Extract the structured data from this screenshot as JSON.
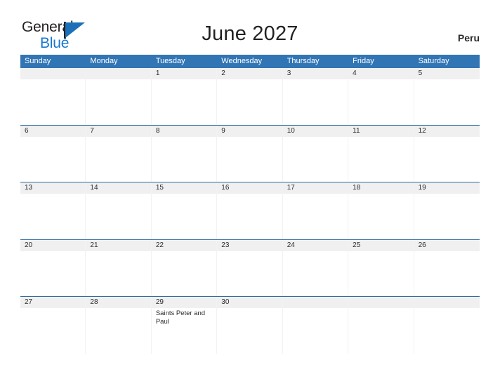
{
  "brand": {
    "name_part1": "General",
    "name_part2": "Blue",
    "flag_icon": "flag-icon",
    "accent_color": "#1878cf"
  },
  "header": {
    "title": "June 2027",
    "country": "Peru"
  },
  "calendar": {
    "header_color": "#3175b5",
    "band_color": "#f0f0f0",
    "weekdays": [
      "Sunday",
      "Monday",
      "Tuesday",
      "Wednesday",
      "Thursday",
      "Friday",
      "Saturday"
    ],
    "weeks": [
      [
        {
          "day": "",
          "events": []
        },
        {
          "day": "",
          "events": []
        },
        {
          "day": "1",
          "events": []
        },
        {
          "day": "2",
          "events": []
        },
        {
          "day": "3",
          "events": []
        },
        {
          "day": "4",
          "events": []
        },
        {
          "day": "5",
          "events": []
        }
      ],
      [
        {
          "day": "6",
          "events": []
        },
        {
          "day": "7",
          "events": []
        },
        {
          "day": "8",
          "events": []
        },
        {
          "day": "9",
          "events": []
        },
        {
          "day": "10",
          "events": []
        },
        {
          "day": "11",
          "events": []
        },
        {
          "day": "12",
          "events": []
        }
      ],
      [
        {
          "day": "13",
          "events": []
        },
        {
          "day": "14",
          "events": []
        },
        {
          "day": "15",
          "events": []
        },
        {
          "day": "16",
          "events": []
        },
        {
          "day": "17",
          "events": []
        },
        {
          "day": "18",
          "events": []
        },
        {
          "day": "19",
          "events": []
        }
      ],
      [
        {
          "day": "20",
          "events": []
        },
        {
          "day": "21",
          "events": []
        },
        {
          "day": "22",
          "events": []
        },
        {
          "day": "23",
          "events": []
        },
        {
          "day": "24",
          "events": []
        },
        {
          "day": "25",
          "events": []
        },
        {
          "day": "26",
          "events": []
        }
      ],
      [
        {
          "day": "27",
          "events": []
        },
        {
          "day": "28",
          "events": []
        },
        {
          "day": "29",
          "events": [
            "Saints Peter and Paul"
          ]
        },
        {
          "day": "30",
          "events": []
        },
        {
          "day": "",
          "events": []
        },
        {
          "day": "",
          "events": []
        },
        {
          "day": "",
          "events": []
        }
      ]
    ]
  }
}
